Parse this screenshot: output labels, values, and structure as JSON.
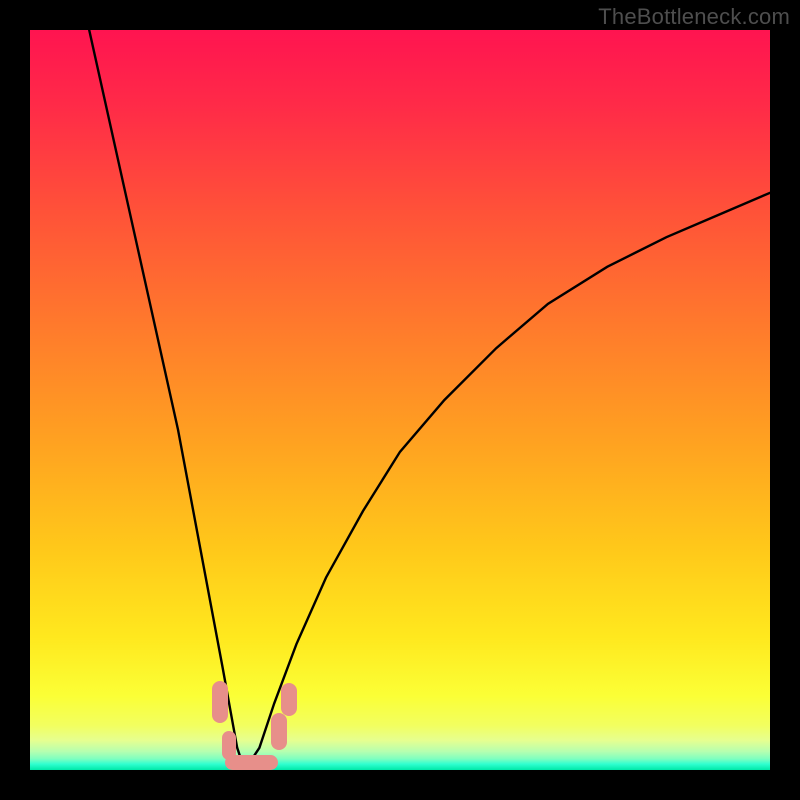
{
  "watermark": "TheBottleneck.com",
  "chart_data": {
    "type": "line",
    "title": "",
    "xlabel": "",
    "ylabel": "",
    "xlim": [
      0,
      1
    ],
    "ylim": [
      0,
      1
    ],
    "note": "V-shaped bottleneck curve over a red-to-green vertical gradient background. X and Y are normalized to plot area (0-1). Curve minimum near x≈0.29 at y≈0 (bottom). Left branch starts near (0.08, 1) and drops steeply; right branch rises concavely to about (1.0, 0.78).",
    "series": [
      {
        "name": "bottleneck-curve",
        "x": [
          0.08,
          0.12,
          0.16,
          0.2,
          0.23,
          0.26,
          0.28,
          0.29,
          0.31,
          0.33,
          0.36,
          0.4,
          0.45,
          0.5,
          0.56,
          0.63,
          0.7,
          0.78,
          0.86,
          0.93,
          1.0
        ],
        "y": [
          1.0,
          0.82,
          0.64,
          0.46,
          0.3,
          0.14,
          0.03,
          0.0,
          0.03,
          0.09,
          0.17,
          0.26,
          0.35,
          0.43,
          0.5,
          0.57,
          0.63,
          0.68,
          0.72,
          0.75,
          0.78
        ]
      }
    ],
    "markers": [
      {
        "cx": 0.257,
        "cy": 0.092,
        "rx": 0.011,
        "ry": 0.028
      },
      {
        "cx": 0.269,
        "cy": 0.033,
        "rx": 0.01,
        "ry": 0.02
      },
      {
        "cx": 0.288,
        "cy": 0.01,
        "rx": 0.025,
        "ry": 0.01
      },
      {
        "cx": 0.315,
        "cy": 0.01,
        "rx": 0.02,
        "ry": 0.01
      },
      {
        "cx": 0.336,
        "cy": 0.052,
        "rx": 0.011,
        "ry": 0.025
      },
      {
        "cx": 0.35,
        "cy": 0.095,
        "rx": 0.011,
        "ry": 0.022
      }
    ],
    "gradient_stops": [
      {
        "pos": 0.0,
        "color": "#ff1450"
      },
      {
        "pos": 0.4,
        "color": "#ff7a2c"
      },
      {
        "pos": 0.82,
        "color": "#ffe81e"
      },
      {
        "pos": 0.96,
        "color": "#e6ff90"
      },
      {
        "pos": 1.0,
        "color": "#00e8a8"
      }
    ]
  }
}
